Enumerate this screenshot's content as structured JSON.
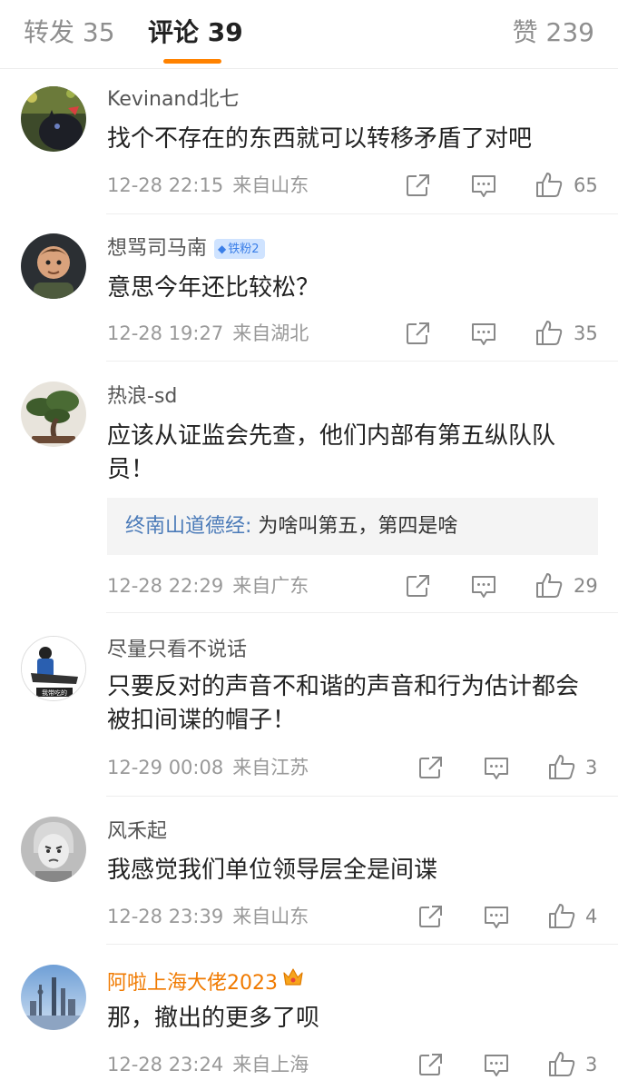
{
  "tabs": {
    "repost": "转发 35",
    "comments": "评论 39",
    "likes": "赞 239"
  },
  "colors": {
    "accent": "#ff8200",
    "vip_name": "#f07a00",
    "quote_name": "#4a7ab8",
    "badge_bg": "#cfe3ff"
  },
  "comments": [
    {
      "user": "Kevinand北七",
      "avatar": "cat-in-garden-avatar",
      "text": "找个不存在的东西就可以转移矛盾了对吧",
      "time": "12-28 22:15",
      "location": "来自山东",
      "likes": "65"
    },
    {
      "user": "想骂司马南",
      "badge": "铁粉2",
      "avatar": "cartoon-character-avatar",
      "text": "意思今年还比较松？",
      "time": "12-28 19:27",
      "location": "来自湖北",
      "likes": "35"
    },
    {
      "user": "热浪-sd",
      "avatar": "bonsai-tree-avatar",
      "text": "应该从证监会先查，他们内部有第五纵队队员！",
      "reply": {
        "name": "终南山道德经:",
        "text": " 为啥叫第五，第四是啥"
      },
      "time": "12-28 22:29",
      "location": "来自广东",
      "likes": "29"
    },
    {
      "user": "尽量只看不说话",
      "avatar": "cartoon-sticker-avatar",
      "avatar_caption": "我带吃的",
      "text": "只要反对的声音不和谐的声音和行为估计都会被扣间谍的帽子！",
      "time": "12-29 00:08",
      "location": "来自江苏",
      "likes": "3"
    },
    {
      "user": "风禾起",
      "avatar": "grumpy-child-avatar",
      "text": "我感觉我们单位领导层全是间谍",
      "time": "12-28 23:39",
      "location": "来自山东",
      "likes": "4"
    },
    {
      "user": "阿啦上海大佬2023",
      "vip": true,
      "avatar": "shanghai-skyline-avatar",
      "text": "那，撤出的更多了呗",
      "time": "12-28 23:24",
      "location": "来自上海",
      "likes": "3"
    }
  ]
}
